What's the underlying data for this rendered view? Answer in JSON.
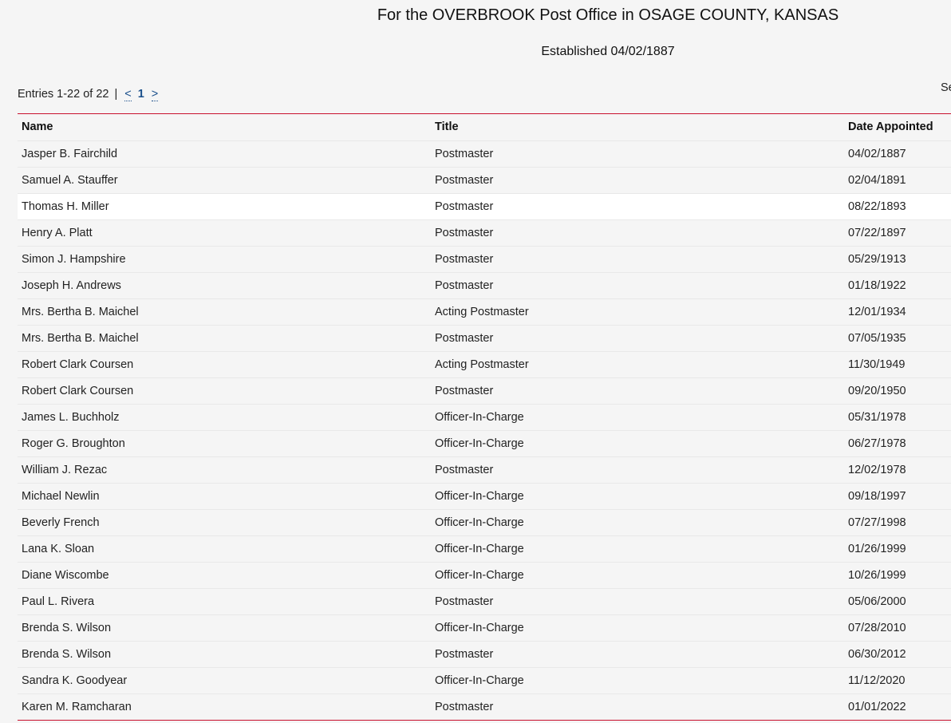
{
  "header": {
    "title": "For the OVERBROOK Post Office in OSAGE COUNTY, KANSAS",
    "established": "Established 04/02/1887"
  },
  "pager": {
    "entries": "Entries 1-22 of 22",
    "separator": "|",
    "prev": "<",
    "current_page": "1",
    "next": ">"
  },
  "search": {
    "label_fragment": "Se"
  },
  "table": {
    "columns": [
      "Name",
      "Title",
      "Date Appointed"
    ],
    "rows": [
      {
        "name": "Jasper B. Fairchild",
        "title": "Postmaster",
        "date": "04/02/1887"
      },
      {
        "name": "Samuel A. Stauffer",
        "title": "Postmaster",
        "date": "02/04/1891"
      },
      {
        "name": "Thomas H. Miller",
        "title": "Postmaster",
        "date": "08/22/1893"
      },
      {
        "name": "Henry A. Platt",
        "title": "Postmaster",
        "date": "07/22/1897"
      },
      {
        "name": "Simon J. Hampshire",
        "title": "Postmaster",
        "date": "05/29/1913"
      },
      {
        "name": "Joseph H. Andrews",
        "title": "Postmaster",
        "date": "01/18/1922"
      },
      {
        "name": "Mrs. Bertha B. Maichel",
        "title": "Acting Postmaster",
        "date": "12/01/1934"
      },
      {
        "name": "Mrs. Bertha B. Maichel",
        "title": "Postmaster",
        "date": "07/05/1935"
      },
      {
        "name": "Robert Clark Coursen",
        "title": "Acting Postmaster",
        "date": "11/30/1949"
      },
      {
        "name": "Robert Clark Coursen",
        "title": "Postmaster",
        "date": "09/20/1950"
      },
      {
        "name": "James L. Buchholz",
        "title": "Officer-In-Charge",
        "date": "05/31/1978"
      },
      {
        "name": "Roger G. Broughton",
        "title": "Officer-In-Charge",
        "date": "06/27/1978"
      },
      {
        "name": "William J. Rezac",
        "title": "Postmaster",
        "date": "12/02/1978"
      },
      {
        "name": "Michael Newlin",
        "title": "Officer-In-Charge",
        "date": "09/18/1997"
      },
      {
        "name": "Beverly French",
        "title": "Officer-In-Charge",
        "date": "07/27/1998"
      },
      {
        "name": "Lana K. Sloan",
        "title": "Officer-In-Charge",
        "date": "01/26/1999"
      },
      {
        "name": "Diane Wiscombe",
        "title": "Officer-In-Charge",
        "date": "10/26/1999"
      },
      {
        "name": "Paul L. Rivera",
        "title": "Postmaster",
        "date": "05/06/2000"
      },
      {
        "name": "Brenda S. Wilson",
        "title": "Officer-In-Charge",
        "date": "07/28/2010"
      },
      {
        "name": "Brenda S. Wilson",
        "title": "Postmaster",
        "date": "06/30/2012"
      },
      {
        "name": "Sandra K. Goodyear",
        "title": "Officer-In-Charge",
        "date": "11/12/2020"
      },
      {
        "name": "Karen M. Ramcharan",
        "title": "Postmaster",
        "date": "01/01/2022"
      }
    ]
  },
  "colors": {
    "accent_border": "#c8102e",
    "link": "#1a4f8b",
    "background": "#f5f5f5",
    "hover_row": "#ffffff"
  }
}
